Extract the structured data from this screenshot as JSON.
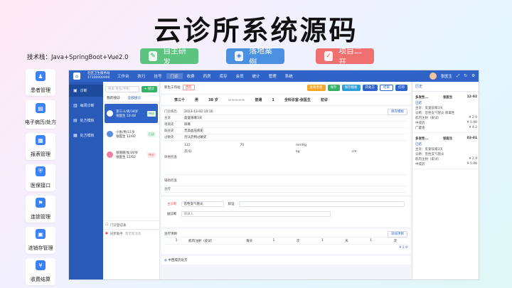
{
  "hero": {
    "title": "云诊所系统源码",
    "tech": "技术栈：Java+SpringBoot+Vue2.0"
  },
  "badges": [
    {
      "label": "自主研发",
      "icon": "✎"
    },
    {
      "label": "落地案例",
      "icon": "◈"
    },
    {
      "label": "项目二开",
      "icon": "✓"
    }
  ],
  "features": [
    {
      "label": "患者管理",
      "icon": "♟"
    },
    {
      "label": "电子病历/处方",
      "icon": "▤"
    },
    {
      "label": "报表管理",
      "icon": "▦"
    },
    {
      "label": "医保接口",
      "icon": "⛨"
    },
    {
      "label": "连锁管理",
      "icon": "⚑"
    },
    {
      "label": "进销存管理",
      "icon": "▣"
    },
    {
      "label": "收费结算",
      "icon": "¥"
    }
  ],
  "app": {
    "clinic_name": "社区卫生服务站",
    "clinic_phone": "17100000000",
    "nav": [
      "工作台",
      "执行",
      "挂号",
      "门诊",
      "收费",
      "药房",
      "库存",
      "会员",
      "统计",
      "管理",
      "系统"
    ],
    "active_nav": "门诊",
    "user": "张医生",
    "sidebar": [
      {
        "label": "诊断",
        "icon": "▣"
      },
      {
        "label": "每周诊断",
        "icon": "▥"
      },
      {
        "label": "处方模板",
        "icon": "▤"
      },
      {
        "label": "处方模板",
        "icon": "▦"
      }
    ],
    "patient_list": {
      "search_placeholder": "搜索 姓名/手机",
      "add_btn": "+ 接诊",
      "tabs": [
        "我的接诊",
        "全部接诊"
      ],
      "patients": [
        {
          "name": "李三十/男/38岁",
          "info": "张医生  10:48",
          "tag": "待诊"
        },
        {
          "name": "小张/男/11岁",
          "info": "张医生  12/02",
          "tag": "已诊"
        },
        {
          "name": "张丽丽/女/20岁",
          "info": "张医生  12/02",
          "tag": "待诊"
        }
      ],
      "footer": [
        "门诊登记表",
        "同步助手"
      ],
      "footer_sub": "暂无新消息"
    },
    "toolbar": {
      "label": "新生工作站",
      "tag": "西医",
      "buttons": [
        "查看患者",
        "保存",
        "保存模板",
        "开处方",
        "结束",
        "打印"
      ]
    },
    "patient": {
      "name": "李三十",
      "gender": "男",
      "age": "38",
      "unit": "岁",
      "type": "普通",
      "visits": "1",
      "doctor": "全科诊室-张医生",
      "status": "初诊"
    },
    "record": {
      "title": "门诊病历",
      "time": "2023-12-02 10:16",
      "btn": "保存模板",
      "fields": [
        {
          "k": "主诉",
          "v": "反复咳嗽3天"
        },
        {
          "k": "现病史",
          "v": "咳嗽"
        },
        {
          "k": "既往史",
          "v": "无高血压病史"
        },
        {
          "k": "过敏史",
          "v": "否认药物过敏史"
        }
      ],
      "vitals_label": "体格检查",
      "vitals": [
        "112",
        "70",
        "mmHg",
        "",
        "次/分",
        "",
        "kg",
        "cm"
      ],
      "aux": "辅助检查",
      "treat": "治疗"
    },
    "diagnosis": {
      "label": "主诊断",
      "value": "急性支气管炎",
      "label2": "辩证",
      "label3": "副诊断",
      "value3": "请录入"
    },
    "treatment": {
      "title": "治疗项目",
      "btn": "添加项目",
      "row": [
        "1",
        "肌肉注射（皮试）",
        "",
        "每天",
        "1",
        "次",
        "1",
        "天",
        "1",
        "次"
      ],
      "total": "¥ 2.9"
    },
    "rx_title": "中西成药处方",
    "history": {
      "title": "历史",
      "cards": [
        {
          "diag": "多发性...",
          "doctor": "张医生",
          "date": "12-02",
          "status": "已结",
          "lines": [
            "主诉：反复咳嗽3天",
            "诊断：急性支气管炎 病毒性"
          ],
          "items": [
            {
              "n": "肌内注射（皮试）",
              "p": "¥ 2.9"
            },
            {
              "n": "中成药",
              "p": "¥ 5.96"
            },
            {
              "n": "广藿香",
              "p": "¥ 4.2"
            }
          ]
        },
        {
          "diag": "多发性...",
          "doctor": "张医生",
          "date": "03-01",
          "status": "已结",
          "lines": [
            "主诉：反复咳嗽3天",
            "诊断：急性支气管炎"
          ],
          "items": [
            {
              "n": "肌内注射（皮试）",
              "p": "¥ 2.9"
            },
            {
              "n": "中成药",
              "p": "¥ 5.96"
            }
          ]
        }
      ]
    }
  }
}
